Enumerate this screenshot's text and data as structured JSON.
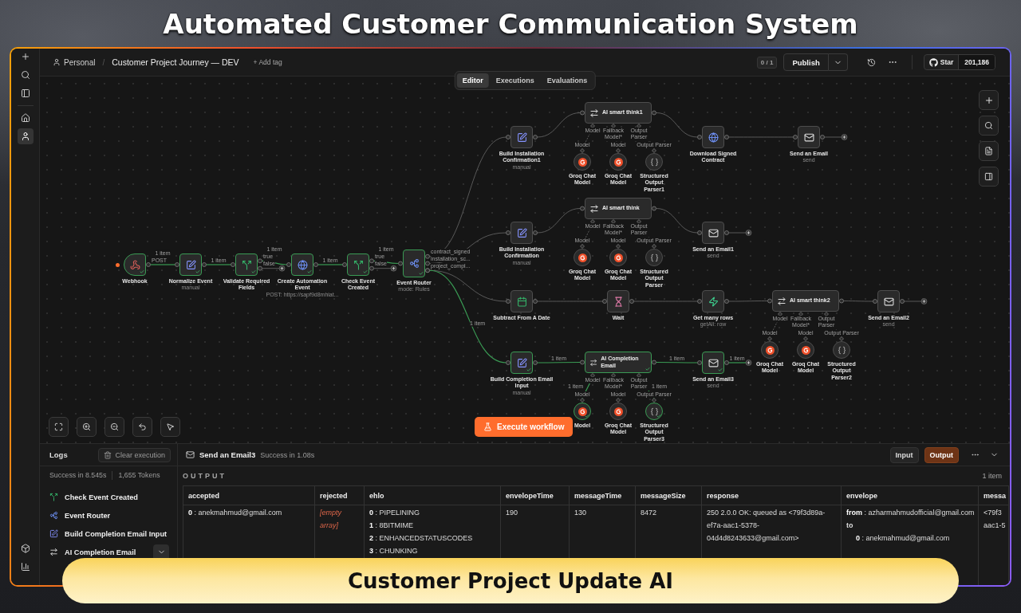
{
  "title": "Automated Customer Communication System",
  "sidebar": {
    "top": [
      {
        "kind": "plus",
        "selected": false
      },
      {
        "kind": "search",
        "selected": false
      },
      {
        "kind": "panel",
        "selected": false
      }
    ],
    "nav": [
      {
        "kind": "home",
        "selected": false
      },
      {
        "kind": "user",
        "selected": true
      }
    ],
    "bottom": [
      {
        "kind": "box",
        "selected": false
      },
      {
        "kind": "chart",
        "selected": false
      }
    ]
  },
  "header": {
    "workspace": "Personal",
    "separator": "/",
    "workflow": "Customer Project Journey — DEV",
    "add_tag": "+ Add tag",
    "counter": "0 / 1",
    "publish": "Publish",
    "star": "Star",
    "star_count": "201,186"
  },
  "tabs": [
    {
      "label": "Editor",
      "selected": true
    },
    {
      "label": "Executions",
      "selected": false
    },
    {
      "label": "Evaluations",
      "selected": false
    }
  ],
  "canvas": {
    "nodes": [
      {
        "label": "Webhook",
        "kind": "webhook",
        "executed": true,
        "outputs": [
          "POST"
        ]
      },
      {
        "label": "Normalize Event",
        "subtitle": "manual",
        "kind": "edit",
        "executed": true
      },
      {
        "label": "Validate Required Fields",
        "kind": "if",
        "executed": true,
        "outputs": [
          "true",
          "false"
        ]
      },
      {
        "label": "Create Automation Event",
        "subtitle": "POST: https://sapf9d8mhiat...",
        "kind": "globe",
        "executed": true
      },
      {
        "label": "Check Event Created",
        "kind": "if",
        "executed": true,
        "outputs": [
          "true",
          "false"
        ]
      },
      {
        "label": "Event Router",
        "subtitle": "mode: Rules",
        "kind": "router",
        "executed": true,
        "outputs": [
          "contract_signed",
          "installation_sc...",
          "project_compl..."
        ]
      },
      {
        "label": "Build Installation Confirmation1",
        "subtitle": "manual",
        "kind": "edit",
        "executed": false
      },
      {
        "label": "AI smart think1",
        "kind": "agent",
        "executed": false,
        "inputs": [
          "Model",
          "Fallback Model*",
          "Output Parser"
        ]
      },
      {
        "label": "Groq Chat Model",
        "kind": "model",
        "executed": false,
        "port": "Model"
      },
      {
        "label": "Groq Chat Model",
        "kind": "model",
        "executed": false,
        "port": "Model"
      },
      {
        "label": "Structured Output Parser1",
        "kind": "parser",
        "executed": false,
        "port": "Output Parser"
      },
      {
        "label": "Download Signed Contract",
        "kind": "globe",
        "executed": false
      },
      {
        "label": "Send an Email",
        "subtitle": "send",
        "kind": "mail",
        "executed": false
      },
      {
        "label": "Build Installation Confirmation",
        "subtitle": "manual",
        "kind": "edit",
        "executed": false
      },
      {
        "label": "AI smart think",
        "kind": "agent",
        "executed": false,
        "inputs": [
          "Model",
          "Fallback Model*",
          "Output Parser"
        ]
      },
      {
        "label": "Groq Chat Model",
        "kind": "model",
        "executed": false,
        "port": "Model"
      },
      {
        "label": "Groq Chat Model",
        "kind": "model",
        "executed": false,
        "port": "Model"
      },
      {
        "label": "Structured Output Parser",
        "kind": "parser",
        "executed": false,
        "port": "Output Parser"
      },
      {
        "label": "Send an Email1",
        "subtitle": "send",
        "kind": "mail",
        "executed": false
      },
      {
        "label": "Subtract From A Date",
        "kind": "calendar",
        "executed": false
      },
      {
        "label": "Wait",
        "kind": "hourglass",
        "executed": false
      },
      {
        "label": "Get many rows",
        "subtitle": "getAll: row",
        "kind": "bolt",
        "executed": false
      },
      {
        "label": "AI smart think2",
        "kind": "agent",
        "executed": false,
        "inputs": [
          "Model",
          "Fallback Model*",
          "Output Parser"
        ]
      },
      {
        "label": "Groq Chat Model",
        "kind": "model",
        "executed": false,
        "port": "Model"
      },
      {
        "label": "Groq Chat Model",
        "kind": "model",
        "executed": false,
        "port": "Model"
      },
      {
        "label": "Structured Output Parser2",
        "kind": "parser",
        "executed": false,
        "port": "Output Parser"
      },
      {
        "label": "Send an Email2",
        "subtitle": "send",
        "kind": "mail",
        "executed": false
      },
      {
        "label": "Build Completion Email Input",
        "subtitle": "manual",
        "kind": "edit",
        "executed": true
      },
      {
        "label": "AI Completion Email",
        "kind": "agent",
        "executed": true,
        "inputs": [
          "Model",
          "Fallback Model*",
          "Output Parser"
        ]
      },
      {
        "label": "Model",
        "kind": "model",
        "executed": true,
        "port": "Model"
      },
      {
        "label": "Groq Chat Model",
        "kind": "model",
        "executed": false,
        "port": "Model"
      },
      {
        "label": "Structured Output Parser3",
        "kind": "parser",
        "executed": true,
        "port": "Output Parser"
      },
      {
        "label": "Send an Email3",
        "subtitle": "send",
        "kind": "mail",
        "executed": true
      }
    ],
    "connections": [
      {
        "executed": true,
        "label": "1 item"
      },
      {
        "executed": true,
        "label": "1 item"
      },
      {
        "executed": true,
        "label": "1 item"
      },
      {
        "executed": false
      },
      {
        "executed": true,
        "label": "1 item"
      },
      {
        "executed": true,
        "label": "1 item"
      },
      {
        "executed": false
      },
      {
        "executed": false
      },
      {
        "executed": false
      },
      {
        "executed": false
      },
      {
        "executed": true,
        "label": "1 item"
      },
      {
        "executed": false
      },
      {
        "executed": false
      },
      {
        "executed": false
      },
      {
        "executed": false
      },
      {
        "executed": false
      },
      {
        "executed": false
      },
      {
        "executed": false
      },
      {
        "executed": false
      },
      {
        "executed": false
      },
      {
        "executed": false
      },
      {
        "executed": false
      },
      {
        "executed": false
      },
      {
        "executed": true,
        "label": "1 item"
      },
      {
        "executed": true,
        "label": "1 item"
      },
      {
        "executed": true,
        "label": "1 item"
      },
      {
        "executed": false
      },
      {
        "executed": false
      },
      {
        "executed": false
      },
      {
        "executed": false
      },
      {
        "executed": false
      },
      {
        "executed": false
      },
      {
        "executed": false
      },
      {
        "executed": false
      },
      {
        "executed": false
      },
      {
        "executed": true,
        "label": "1 item"
      },
      {
        "executed": false
      },
      {
        "executed": true,
        "label": "1 item"
      }
    ],
    "execute": "Execute workflow"
  },
  "logs": {
    "title": "Logs",
    "clear": "Clear execution",
    "summary": "Success in 8.545s",
    "tokens": "1,655 Tokens",
    "entries": [
      {
        "label": "Check Event Created",
        "kind": "if"
      },
      {
        "label": "Event Router",
        "kind": "router"
      },
      {
        "label": "Build Completion Email Input",
        "kind": "edit"
      },
      {
        "label": "AI Completion Email",
        "kind": "agent",
        "expanded": true
      }
    ]
  },
  "output": {
    "node": "Send an Email3",
    "status": "Success in 1.08s",
    "views": [
      {
        "label": "Input",
        "selected": false
      },
      {
        "label": "Output",
        "selected": true
      }
    ],
    "section": "OUTPUT",
    "count": "1 item",
    "columns": [
      "accepted",
      "rejected",
      "ehlo",
      "envelopeTime",
      "messageTime",
      "messageSize",
      "response",
      "envelope",
      "messa"
    ],
    "cells": [
      {
        "kind": "tree",
        "entries": [
          {
            "text": "**0** : anekmahmud@gmail.com"
          }
        ]
      },
      {
        "kind": "empty",
        "text": "[empty array]"
      },
      {
        "kind": "tree",
        "entries": [
          {
            "text": "**0** : PIPELINING"
          },
          {
            "text": "**1** : 8BITMIME"
          },
          {
            "text": "**2** : ENHANCEDSTATUSCODES"
          },
          {
            "text": "**3** : CHUNKING"
          }
        ]
      },
      {
        "kind": "text",
        "text": "190"
      },
      {
        "kind": "text",
        "text": "130"
      },
      {
        "kind": "text",
        "text": "8472"
      },
      {
        "kind": "text",
        "text": "250 2.0.0 OK: queued as <79f3d89a-ef7a-aac1-5378-04d4d8243633@gmail.com>"
      },
      {
        "kind": "tree",
        "entries": [
          {
            "text": "**from** : azharmahmudofficial@gmail.com"
          },
          {
            "text": "to",
            "children": [
              {
                "text": "**0** : anekmahmud@gmail.com"
              }
            ]
          }
        ]
      },
      {
        "kind": "lines",
        "lines": [
          "<79f3",
          "aac1-5"
        ]
      }
    ]
  },
  "banner": "Customer Project Update AI"
}
